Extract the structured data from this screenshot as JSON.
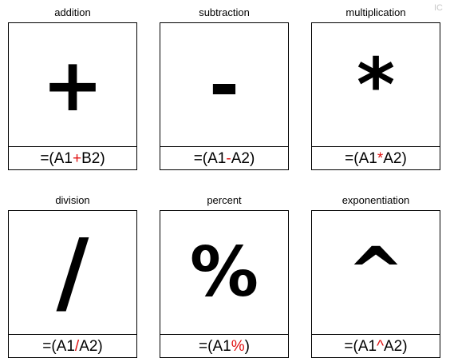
{
  "watermark": "IC",
  "cards": [
    {
      "title": "addition",
      "symbol": "+",
      "formula": {
        "prefix": "=(A1",
        "op": "+",
        "suffix": "B2)"
      }
    },
    {
      "title": "subtraction",
      "symbol": "-",
      "formula": {
        "prefix": "=(A1",
        "op": "-",
        "suffix": "A2)"
      }
    },
    {
      "title": "multiplication",
      "symbol": "*",
      "formula": {
        "prefix": "=(A1",
        "op": "*",
        "suffix": "A2)"
      }
    },
    {
      "title": "division",
      "symbol": "/",
      "formula": {
        "prefix": "=(A1",
        "op": "/",
        "suffix": "A2)"
      }
    },
    {
      "title": "percent",
      "symbol": "%",
      "formula": {
        "prefix": "=(A1",
        "op": "%",
        "suffix": ")"
      }
    },
    {
      "title": "exponentiation",
      "symbol": "^",
      "formula": {
        "prefix": "=(A1",
        "op": "^",
        "suffix": "A2)"
      }
    }
  ],
  "colors": {
    "operator": "#e01010",
    "border": "#000000",
    "text": "#000000"
  }
}
